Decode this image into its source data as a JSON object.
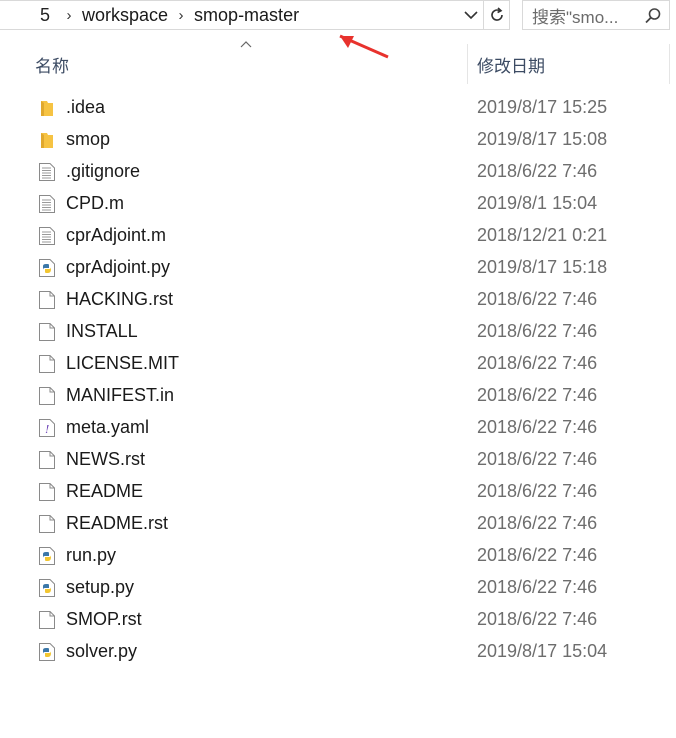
{
  "address_bar": {
    "truncated_prefix": "5",
    "crumbs": [
      "workspace",
      "smop-master"
    ],
    "search_placeholder": "搜索\"smo..."
  },
  "columns": {
    "name": "名称",
    "date_modified": "修改日期"
  },
  "files": [
    {
      "name": ".idea",
      "date": "2019/8/17 15:25",
      "icon": "folder-icon"
    },
    {
      "name": "smop",
      "date": "2019/8/17 15:08",
      "icon": "folder-icon"
    },
    {
      "name": ".gitignore",
      "date": "2018/6/22 7:46",
      "icon": "text-file-icon"
    },
    {
      "name": "CPD.m",
      "date": "2019/8/1 15:04",
      "icon": "text-file-icon"
    },
    {
      "name": "cprAdjoint.m",
      "date": "2018/12/21 0:21",
      "icon": "text-file-icon"
    },
    {
      "name": "cprAdjoint.py",
      "date": "2019/8/17 15:18",
      "icon": "python-file-icon"
    },
    {
      "name": "HACKING.rst",
      "date": "2018/6/22 7:46",
      "icon": "blank-file-icon"
    },
    {
      "name": "INSTALL",
      "date": "2018/6/22 7:46",
      "icon": "blank-file-icon"
    },
    {
      "name": "LICENSE.MIT",
      "date": "2018/6/22 7:46",
      "icon": "blank-file-icon"
    },
    {
      "name": "MANIFEST.in",
      "date": "2018/6/22 7:46",
      "icon": "blank-file-icon"
    },
    {
      "name": "meta.yaml",
      "date": "2018/6/22 7:46",
      "icon": "yaml-file-icon"
    },
    {
      "name": "NEWS.rst",
      "date": "2018/6/22 7:46",
      "icon": "blank-file-icon"
    },
    {
      "name": "README",
      "date": "2018/6/22 7:46",
      "icon": "blank-file-icon"
    },
    {
      "name": "README.rst",
      "date": "2018/6/22 7:46",
      "icon": "blank-file-icon"
    },
    {
      "name": "run.py",
      "date": "2018/6/22 7:46",
      "icon": "python-file-icon"
    },
    {
      "name": "setup.py",
      "date": "2018/6/22 7:46",
      "icon": "python-file-icon"
    },
    {
      "name": "SMOP.rst",
      "date": "2018/6/22 7:46",
      "icon": "blank-file-icon"
    },
    {
      "name": "solver.py",
      "date": "2019/8/17 15:04",
      "icon": "python-file-icon"
    }
  ],
  "colors": {
    "folder": "#f6c343",
    "header_text": "#3c4b63",
    "date_text": "#6d6d6d",
    "annotation_arrow": "#e8322d"
  }
}
